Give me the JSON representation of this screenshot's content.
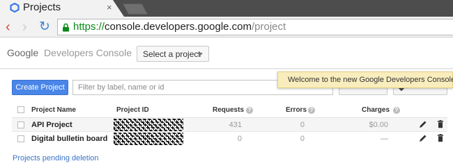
{
  "browser": {
    "tab_title": "Projects",
    "tab_close": "×",
    "back": "‹",
    "forward": "›",
    "reload": "↻",
    "url_scheme": "https://",
    "url_host": "console.developers.google.com",
    "url_path": "/project"
  },
  "header": {
    "brand_google": "Google",
    "brand_product": "Developers Console",
    "project_select": "Select a project"
  },
  "toolbar": {
    "create_label": "Create Project",
    "filter_placeholder": "Filter by label, name or id"
  },
  "toast": {
    "message": "Welcome to the new Google Developers Console!"
  },
  "table": {
    "columns": {
      "name": "Project Name",
      "id": "Project ID",
      "requests": "Requests",
      "errors": "Errors",
      "charges": "Charges"
    },
    "help_glyph": "?",
    "rows": [
      {
        "name": "API Project",
        "requests": "431",
        "errors": "0",
        "charges": "$0.00"
      },
      {
        "name": "Digital bulletin board",
        "requests": "0",
        "errors": "0",
        "charges": "—"
      }
    ]
  },
  "footer": {
    "pending_link": "Projects pending deletion"
  },
  "colors": {
    "accent": "#4a86e8",
    "toast_bg": "#f9edbe",
    "link": "#3a73c7",
    "url_secure": "#0a8a18"
  },
  "icons": [
    "hexagon-logo-icon",
    "close-icon",
    "back-icon",
    "forward-icon",
    "reload-icon",
    "lock-icon",
    "caret-down-icon",
    "help-icon",
    "edit-icon",
    "trash-icon",
    "tag-icon"
  ]
}
